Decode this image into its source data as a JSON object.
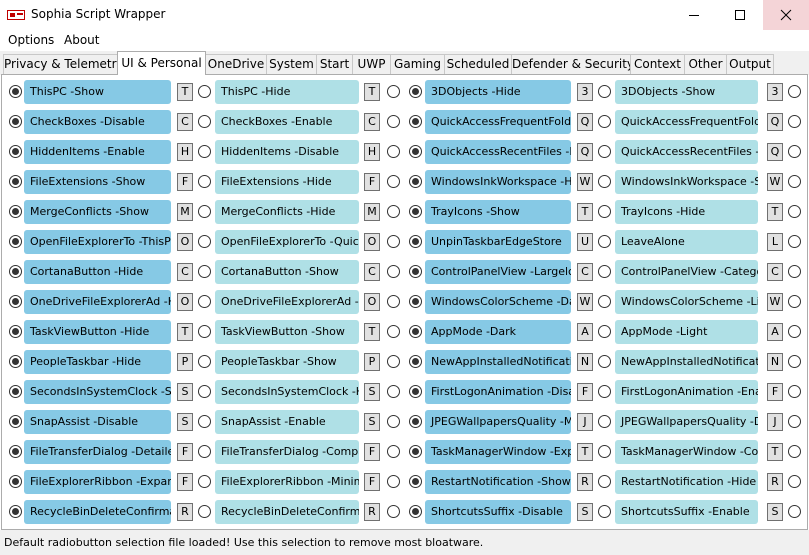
{
  "window": {
    "title": "Sophia Script Wrapper"
  },
  "menu": [
    "Options",
    "About"
  ],
  "tabs": [
    {
      "label": "Privacy & Telemetry",
      "active": false
    },
    {
      "label": "UI & Personal",
      "active": true
    },
    {
      "label": "OneDrive",
      "active": false
    },
    {
      "label": "System",
      "active": false
    },
    {
      "label": "Start",
      "active": false
    },
    {
      "label": "UWP",
      "active": false
    },
    {
      "label": "Gaming",
      "active": false
    },
    {
      "label": "Scheduled",
      "active": false
    },
    {
      "label": "Defender & Security",
      "active": false
    },
    {
      "label": "Context",
      "active": false
    },
    {
      "label": "Other",
      "active": false
    },
    {
      "label": "Output",
      "active": false
    }
  ],
  "groups": [
    [
      {
        "a": "ThisPC -Show",
        "ka": "T",
        "b": "ThisPC -Hide",
        "kb": "T",
        "selected": "a"
      },
      {
        "a": "CheckBoxes -Disable",
        "ka": "C",
        "b": "CheckBoxes -Enable",
        "kb": "C",
        "selected": "a"
      },
      {
        "a": "HiddenItems -Enable",
        "ka": "H",
        "b": "HiddenItems -Disable",
        "kb": "H",
        "selected": "a"
      },
      {
        "a": "FileExtensions -Show",
        "ka": "F",
        "b": "FileExtensions -Hide",
        "kb": "F",
        "selected": "a"
      },
      {
        "a": "MergeConflicts -Show",
        "ka": "M",
        "b": "MergeConflicts -Hide",
        "kb": "M",
        "selected": "a"
      },
      {
        "a": "OpenFileExplorerTo -ThisP",
        "ka": "O",
        "b": "OpenFileExplorerTo -Quick",
        "kb": "O",
        "selected": "a"
      },
      {
        "a": "CortanaButton -Hide",
        "ka": "C",
        "b": "CortanaButton -Show",
        "kb": "C",
        "selected": "a"
      },
      {
        "a": "OneDriveFileExplorerAd -H",
        "ka": "O",
        "b": "OneDriveFileExplorerAd -S",
        "kb": "O",
        "selected": "a"
      },
      {
        "a": "TaskViewButton -Hide",
        "ka": "T",
        "b": "TaskViewButton -Show",
        "kb": "T",
        "selected": "a"
      },
      {
        "a": "PeopleTaskbar -Hide",
        "ka": "P",
        "b": "PeopleTaskbar -Show",
        "kb": "P",
        "selected": "a"
      },
      {
        "a": "SecondsInSystemClock -Sh",
        "ka": "S",
        "b": "SecondsInSystemClock -Hi",
        "kb": "S",
        "selected": "a"
      },
      {
        "a": "SnapAssist -Disable",
        "ka": "S",
        "b": "SnapAssist -Enable",
        "kb": "S",
        "selected": "a"
      },
      {
        "a": "FileTransferDialog -Detaile",
        "ka": "F",
        "b": "FileTransferDialog -Compa",
        "kb": "F",
        "selected": "a"
      },
      {
        "a": "FileExplorerRibbon -Expan",
        "ka": "F",
        "b": "FileExplorerRibbon -Minim",
        "kb": "F",
        "selected": "a"
      },
      {
        "a": "RecycleBinDeleteConfirma",
        "ka": "R",
        "b": "RecycleBinDeleteConfirma",
        "kb": "R",
        "selected": "a"
      }
    ],
    [
      {
        "a": "3DObjects -Hide",
        "ka": "3",
        "b": "3DObjects -Show",
        "kb": "3",
        "selected": "a"
      },
      {
        "a": "QuickAccessFrequentFolde",
        "ka": "Q",
        "b": "QuickAccessFrequentFolde",
        "kb": "Q",
        "selected": "a"
      },
      {
        "a": "QuickAccessRecentFiles -H",
        "ka": "Q",
        "b": "QuickAccessRecentFiles -S",
        "kb": "Q",
        "selected": "a"
      },
      {
        "a": "WindowsInkWorkspace -H",
        "ka": "W",
        "b": "WindowsInkWorkspace -Sh",
        "kb": "W",
        "selected": "a"
      },
      {
        "a": "TrayIcons -Show",
        "ka": "T",
        "b": "TrayIcons -Hide",
        "kb": "T",
        "selected": "a"
      },
      {
        "a": "UnpinTaskbarEdgeStore",
        "ka": "U",
        "b": "LeaveAlone",
        "kb": "L",
        "selected": "a"
      },
      {
        "a": "ControlPanelView -Largelc",
        "ka": "C",
        "b": "ControlPanelView -Catego",
        "kb": "C",
        "selected": "a"
      },
      {
        "a": "WindowsColorScheme -Da",
        "ka": "W",
        "b": "WindowsColorScheme -Lig",
        "kb": "W",
        "selected": "a"
      },
      {
        "a": "AppMode -Dark",
        "ka": "A",
        "b": "AppMode -Light",
        "kb": "A",
        "selected": "a"
      },
      {
        "a": "NewAppInstalledNotificati",
        "ka": "N",
        "b": "NewAppInstalledNotificati",
        "kb": "N",
        "selected": "a"
      },
      {
        "a": "FirstLogonAnimation -Disa",
        "ka": "F",
        "b": "FirstLogonAnimation -Enal",
        "kb": "F",
        "selected": "a"
      },
      {
        "a": "JPEGWallpapersQuality -M",
        "ka": "J",
        "b": "JPEGWallpapersQuality -De",
        "kb": "J",
        "selected": "a"
      },
      {
        "a": "TaskManagerWindow -Exp",
        "ka": "T",
        "b": "TaskManagerWindow -Cor",
        "kb": "T",
        "selected": "a"
      },
      {
        "a": "RestartNotification -Show",
        "ka": "R",
        "b": "RestartNotification -Hide",
        "kb": "R",
        "selected": "a"
      },
      {
        "a": "ShortcutsSuffix -Disable",
        "ka": "S",
        "b": "ShortcutsSuffix -Enable",
        "kb": "S",
        "selected": "a"
      }
    ]
  ],
  "status": {
    "text": "Default radiobutton selection file loaded! Use this selection to remove most bloatware."
  },
  "colors": {
    "selected": "#86c9e5",
    "unselected": "#afe0e6",
    "close_hover": "#f4d4d7"
  }
}
